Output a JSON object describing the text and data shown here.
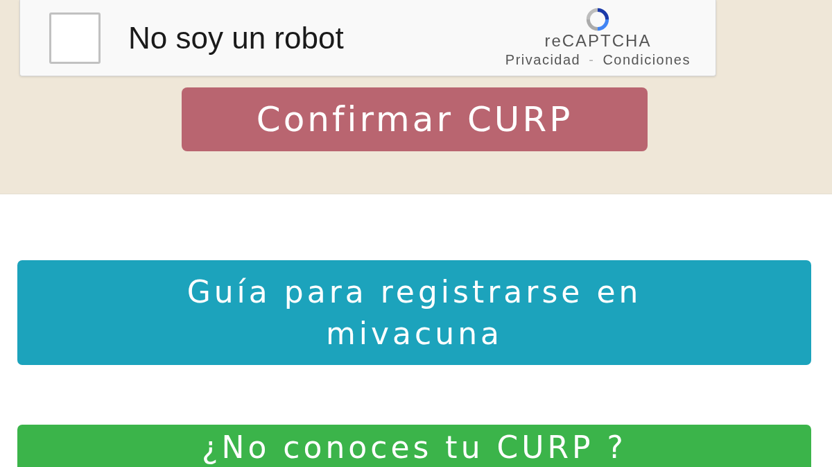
{
  "captcha": {
    "checked": false,
    "label": "No soy un robot",
    "brand": "reCAPTCHA",
    "links": [
      "Privacidad",
      "Condiciones"
    ],
    "separator": "-"
  },
  "confirm_button": {
    "label": "Confirmar CURP"
  },
  "buttons": [
    {
      "kind": "guide",
      "label": "Guía para registrarse en mivacuna"
    },
    {
      "kind": "lookup",
      "label": "¿No conoces tu CURP ?"
    }
  ]
}
